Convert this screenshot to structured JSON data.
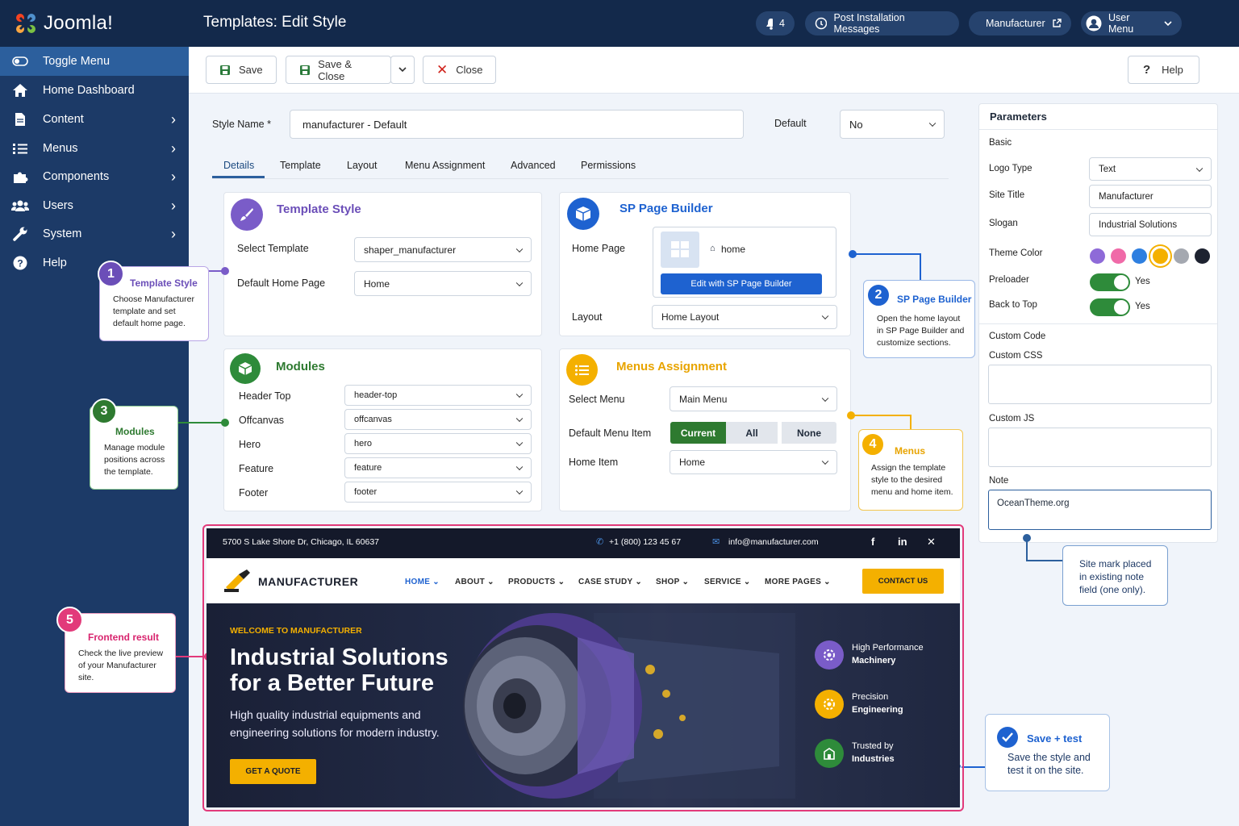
{
  "sidebar": {
    "logo_text": "Joomla!",
    "items": [
      {
        "label": "Toggle Menu",
        "icon": "toggle-icon"
      },
      {
        "label": "Home Dashboard",
        "icon": "home-icon"
      },
      {
        "label": "Content",
        "icon": "file-icon"
      },
      {
        "label": "Menus",
        "icon": "list-icon"
      },
      {
        "label": "Components",
        "icon": "puzzle-icon"
      },
      {
        "label": "Users",
        "icon": "users-icon"
      },
      {
        "label": "System",
        "icon": "wrench-icon"
      },
      {
        "label": "Help",
        "icon": "help-icon"
      }
    ]
  },
  "header": {
    "title": "Templates: Edit Style",
    "notifications_count": "4",
    "post_install": "Post Installation Messages",
    "site_link": "Manufacturer",
    "user_menu": "User Menu"
  },
  "toolbar": {
    "save": "Save",
    "save_close": "Save & Close",
    "close": "Close",
    "help": "Help"
  },
  "form": {
    "style_name_label": "Style Name *",
    "style_name_value": "manufacturer - Default",
    "default_label": "Default",
    "default_value": "No"
  },
  "tabs": [
    "Details",
    "Template",
    "Layout",
    "Menu Assignment",
    "Advanced",
    "Permissions"
  ],
  "template_style": {
    "title": "Template Style",
    "select_template_label": "Select Template",
    "select_template_value": "shaper_manufacturer",
    "default_home_label": "Default Home Page",
    "default_home_value": "Home"
  },
  "sp_builder": {
    "title": "SP Page Builder",
    "home_page_label": "Home Page",
    "home_name": "home",
    "edit_button": "Edit with SP Page Builder",
    "layout_label": "Layout",
    "layout_value": "Home Layout"
  },
  "modules": {
    "title": "Modules",
    "rows": [
      {
        "label": "Header Top",
        "value": "header-top"
      },
      {
        "label": "Offcanvas",
        "value": "offcanvas"
      },
      {
        "label": "Hero",
        "value": "hero"
      },
      {
        "label": "Feature",
        "value": "feature"
      },
      {
        "label": "Footer",
        "value": "footer"
      }
    ]
  },
  "menus_assignment": {
    "title": "Menus Assignment",
    "select_menu_label": "Select Menu",
    "select_menu_value": "Main Menu",
    "default_item_label": "Default Menu Item",
    "seg_current": "Current",
    "seg_all": "All",
    "seg_none": "None",
    "home_item_label": "Home Item",
    "home_item_value": "Home"
  },
  "params": {
    "title": "Parameters",
    "basic": "Basic",
    "logo_type_label": "Logo Type",
    "logo_type_value": "Text",
    "site_title_label": "Site Title",
    "site_title_value": "Manufacturer",
    "slogan_label": "Slogan",
    "slogan_value": "Industrial Solutions",
    "theme_color_label": "Theme Color",
    "theme_colors": [
      "#8e6ad8",
      "#f06aa8",
      "#2e7fe0",
      "#f4b000",
      "#a4a8b0",
      "#1d2230"
    ],
    "preloader_label": "Preloader",
    "preloader_value": "Yes",
    "back_top_label": "Back to Top",
    "back_top_value": "Yes",
    "custom_code": "Custom Code",
    "custom_css": "Custom CSS",
    "custom_js": "Custom JS",
    "note_label": "Note",
    "note_value": "OceanTheme.org"
  },
  "callouts": {
    "c1": {
      "num": "1",
      "title": "Template Style",
      "desc": [
        "Choose Manufacturer",
        "template and set",
        "default home page."
      ]
    },
    "c2": {
      "num": "2",
      "title": "SP Page Builder",
      "desc": [
        "Open the home layout",
        "in SP Page Builder and",
        "customize sections."
      ]
    },
    "c3": {
      "num": "3",
      "title": "Modules",
      "desc": [
        "Manage module",
        "positions across",
        "the template."
      ]
    },
    "c4": {
      "num": "4",
      "title": "Menus",
      "desc": [
        "Assign the template",
        "style to the desired",
        "menu and home item."
      ]
    },
    "c5": {
      "num": "5",
      "title": "Frontend result",
      "desc": [
        "Check the live preview",
        "of your Manufacturer",
        "site."
      ]
    },
    "site_mark": [
      "Site mark placed",
      "in existing note",
      "field (one only)."
    ],
    "save_test": {
      "title": "Save + test",
      "desc": [
        "Save the style and",
        "test it on the site."
      ]
    }
  },
  "preview": {
    "address": "5700 S Lake Shore Dr, Chicago, IL 60637",
    "phone": "+1 (800) 123 45 67",
    "email": "info@manufacturer.com",
    "brand": "MANUFACTURER",
    "menu": [
      "HOME",
      "ABOUT",
      "PRODUCTS",
      "CASE STUDY",
      "SHOP",
      "SERVICE",
      "MORE PAGES"
    ],
    "contact": "CONTACT US",
    "welcome": "WELCOME TO MANUFACTURER",
    "headline1": "Industrial Solutions",
    "headline2": "for a Better Future",
    "sub1": "High quality industrial equipments and",
    "sub2": "engineering solutions for modern industry.",
    "cta": "GET A QUOTE",
    "features": [
      {
        "l1": "High Performance",
        "l2": "Machinery"
      },
      {
        "l1": "Precision",
        "l2": "Engineering"
      },
      {
        "l1": "Trusted by",
        "l2": "Industries"
      }
    ]
  }
}
